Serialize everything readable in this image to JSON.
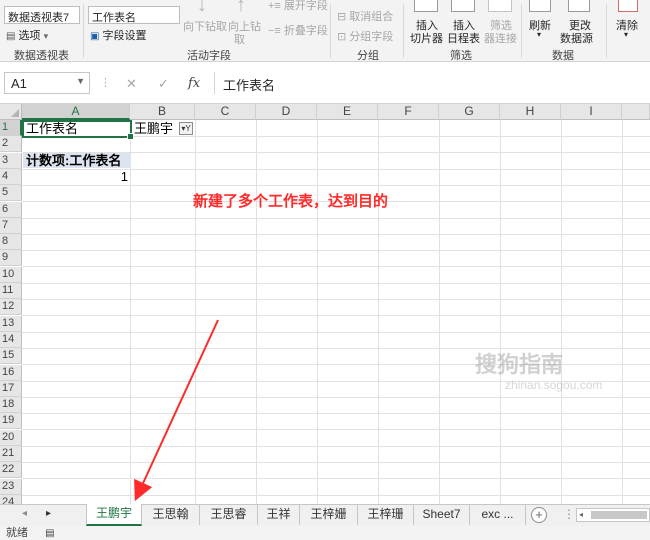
{
  "ribbon": {
    "pivot_name_label": "数据透视表7",
    "options_label": "选项",
    "options_dd": "▾",
    "group_pivot": "数据透视表",
    "active_field_value": "工作表名",
    "field_settings_label": "字段设置",
    "drill_down_label": "向下钻取",
    "drill_up_label": "向上钻",
    "drill_up_label2": "取",
    "expand_field_label": "展开字段",
    "collapse_field_label": "折叠字段",
    "group_active_field": "活动字段",
    "ungroup_label": "取消组合",
    "group_field_label": "分组字段",
    "group_group": "分组",
    "insert_slicer_label": "插入",
    "insert_slicer_label2": "切片器",
    "insert_timeline_label": "插入",
    "insert_timeline_label2": "日程表",
    "filter_conn_label": "筛选",
    "filter_conn_label2": "器连接",
    "group_filter": "筛选",
    "refresh_label": "刷新",
    "change_source_label": "更改",
    "change_source_label2": "数据源",
    "group_data": "数据",
    "clear_label": "清除"
  },
  "formula_bar": {
    "cell_ref": "A1",
    "cancel_icon": "✕",
    "enter_icon": "✓",
    "fx_icon": "fx",
    "content": "工作表名"
  },
  "columns": [
    "A",
    "B",
    "C",
    "D",
    "E",
    "F",
    "G",
    "H",
    "I"
  ],
  "rows": [
    "1",
    "2",
    "3",
    "4",
    "5",
    "6",
    "7",
    "8",
    "9",
    "10",
    "11",
    "12",
    "13",
    "14",
    "15",
    "16",
    "17",
    "18",
    "19",
    "20",
    "21",
    "22",
    "23",
    "24"
  ],
  "cells": {
    "a1": "工作表名",
    "b1": "王鹏宇",
    "a3": "计数项:工作表名",
    "a4": "1"
  },
  "annotation": "新建了多个工作表，达到目的",
  "watermark": {
    "brand": "搜狗指南",
    "url": "zhinan.sogou.com"
  },
  "sheet_tabs": [
    "王鹏宇",
    "王思翰",
    "王思睿",
    "王祥",
    "王梓姗",
    "王梓珊",
    "Sheet7",
    "exc ..."
  ],
  "active_sheet": "王鹏宇",
  "nav": {
    "prev": "◂",
    "next": "▸",
    "add": "+",
    "more": "⋮"
  },
  "status": {
    "mode": "就绪"
  },
  "colors": {
    "accent": "#217346",
    "annotation": "#ff2a2a"
  }
}
